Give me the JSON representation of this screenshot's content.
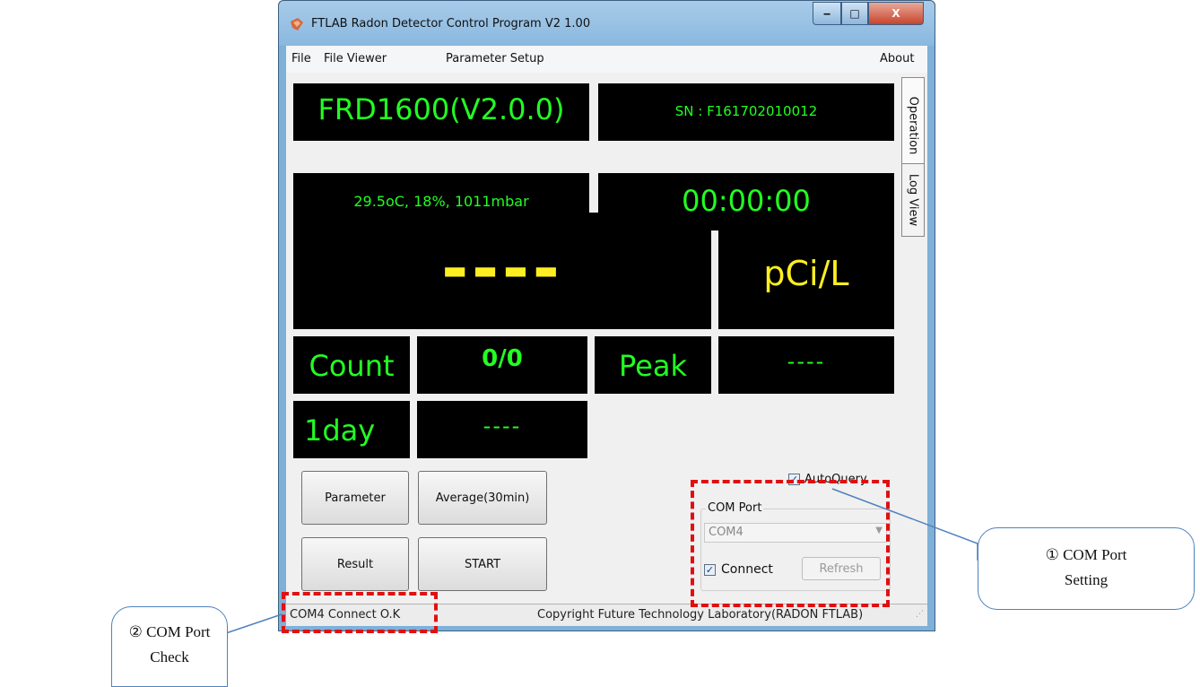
{
  "window": {
    "title": "FTLAB Radon Detector Control Program V2 1.00",
    "min_glyph": "‒",
    "max_glyph": "□",
    "close_glyph": "X"
  },
  "menu": {
    "file": "File",
    "file_viewer": "File Viewer",
    "parameter_setup": "Parameter Setup",
    "about": "About"
  },
  "tabs": {
    "operation": "Operation",
    "log_view": "Log View"
  },
  "display": {
    "model": "FRD1600(V2.0.0)",
    "serial": "SN : F161702010012",
    "environment": "29.5oC, 18%, 1011mbar",
    "timer": "00:00:00",
    "main_value": "----",
    "unit": "pCi/L",
    "count_label": "Count",
    "count_value": "0/0",
    "peak_label": "Peak",
    "peak_value": "----",
    "day_label": "1day",
    "day_value": "----"
  },
  "buttons": {
    "parameter": "Parameter",
    "average": "Average(30min)",
    "result": "Result",
    "start": "START"
  },
  "com": {
    "autoquery_label": "AutoQuery",
    "autoquery_checked": true,
    "group_label": "COM Port",
    "port_value": "COM4",
    "connect_label": "Connect",
    "connect_checked": true,
    "refresh_label": "Refresh"
  },
  "status": {
    "left": "COM4 Connect O.K",
    "right": "Copyright Future Technology Laboratory(RADON FTLAB)"
  },
  "annotations": {
    "setting_line1": "① COM Port",
    "setting_line2": "Setting",
    "check_line1": "② COM Port",
    "check_line2": "Check"
  },
  "colors": {
    "display_bg": "#000000",
    "display_green": "#22ff22",
    "display_yellow": "#ffee22",
    "annotation_dash": "#e01010",
    "callout_border": "#4f81bd"
  }
}
